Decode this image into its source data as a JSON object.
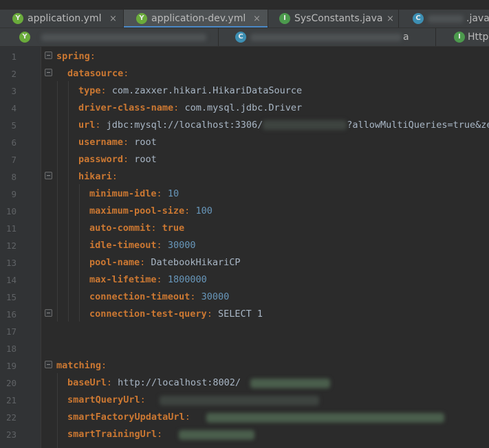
{
  "tabs_row1": [
    {
      "label": "application.yml",
      "icon": "spring-yml-icon",
      "closable": true,
      "active": false
    },
    {
      "label": "application-dev.yml",
      "icon": "spring-yml-icon",
      "closable": true,
      "active": true
    },
    {
      "label": "SysConstants.java",
      "icon": "interface-icon",
      "closable": true,
      "active": false
    },
    {
      "label": ".java",
      "icon": "class-icon",
      "closable": false,
      "active": false
    }
  ],
  "tabs_row2": [
    {
      "label": "",
      "icon": "spring-yml-icon"
    },
    {
      "label": "a",
      "icon": "class-icon"
    },
    {
      "label": "Http",
      "icon": "interface-icon"
    }
  ],
  "icons": {
    "yml": "Y",
    "interface": "I",
    "class": "C"
  },
  "close_glyph": "×",
  "lines": [
    {
      "n": "1",
      "key": "spring",
      "punc": ":",
      "val": "",
      "val_type": ""
    },
    {
      "n": "2",
      "key": "datasource",
      "punc": ":",
      "val": "",
      "val_type": ""
    },
    {
      "n": "3",
      "key": "type",
      "punc": ":",
      "val": " com.zaxxer.hikari.HikariDataSource",
      "val_type": "str"
    },
    {
      "n": "4",
      "key": "driver-class-name",
      "punc": ":",
      "val": " com.mysql.jdbc.Driver",
      "val_type": "str"
    },
    {
      "n": "5",
      "key": "url",
      "punc": ":",
      "val": " jdbc:mysql://localhost:3306/",
      "val_type": "str",
      "tail": "?allowMultiQueries=true&zer"
    },
    {
      "n": "6",
      "key": "username",
      "punc": ":",
      "val": " root",
      "val_type": "str"
    },
    {
      "n": "7",
      "key": "password",
      "punc": ":",
      "val": " root",
      "val_type": "str"
    },
    {
      "n": "8",
      "key": "hikari",
      "punc": ":",
      "val": "",
      "val_type": ""
    },
    {
      "n": "9",
      "key": "minimum-idle",
      "punc": ":",
      "val": " 10",
      "val_type": "num"
    },
    {
      "n": "10",
      "key": "maximum-pool-size",
      "punc": ":",
      "val": " 100",
      "val_type": "num"
    },
    {
      "n": "11",
      "key": "auto-commit",
      "punc": ":",
      "val": " true",
      "val_type": "kw"
    },
    {
      "n": "12",
      "key": "idle-timeout",
      "punc": ":",
      "val": " 30000",
      "val_type": "num"
    },
    {
      "n": "13",
      "key": "pool-name",
      "punc": ":",
      "val": " DatebookHikariCP",
      "val_type": "str"
    },
    {
      "n": "14",
      "key": "max-lifetime",
      "punc": ":",
      "val": " 1800000",
      "val_type": "num"
    },
    {
      "n": "15",
      "key": "connection-timeout",
      "punc": ":",
      "val": " 30000",
      "val_type": "num"
    },
    {
      "n": "16",
      "key": "connection-test-query",
      "punc": ":",
      "val": " SELECT 1",
      "val_type": "str"
    },
    {
      "n": "17",
      "key": "",
      "punc": "",
      "val": "",
      "val_type": ""
    },
    {
      "n": "18",
      "key": "",
      "punc": "",
      "val": "",
      "val_type": ""
    },
    {
      "n": "19",
      "key": "matching",
      "punc": ":",
      "val": "",
      "val_type": ""
    },
    {
      "n": "20",
      "key": "baseUrl",
      "punc": ":",
      "val": " http://localhost:8002/",
      "val_type": "str"
    },
    {
      "n": "21",
      "key": "smartQueryUrl",
      "punc": ":",
      "val": "",
      "val_type": ""
    },
    {
      "n": "22",
      "key": "smartFactoryUpdataUrl",
      "punc": ":",
      "val": "",
      "val_type": ""
    },
    {
      "n": "23",
      "key": "smartTrainingUrl",
      "punc": ":",
      "val": "",
      "val_type": ""
    }
  ],
  "colors": {
    "background": "#2b2b2b",
    "gutter": "#313335",
    "yaml_key": "#cc7832",
    "number": "#6897bb",
    "text": "#a9b7c6",
    "line_number": "#606366",
    "active_tab_underline": "#4a88c7"
  }
}
